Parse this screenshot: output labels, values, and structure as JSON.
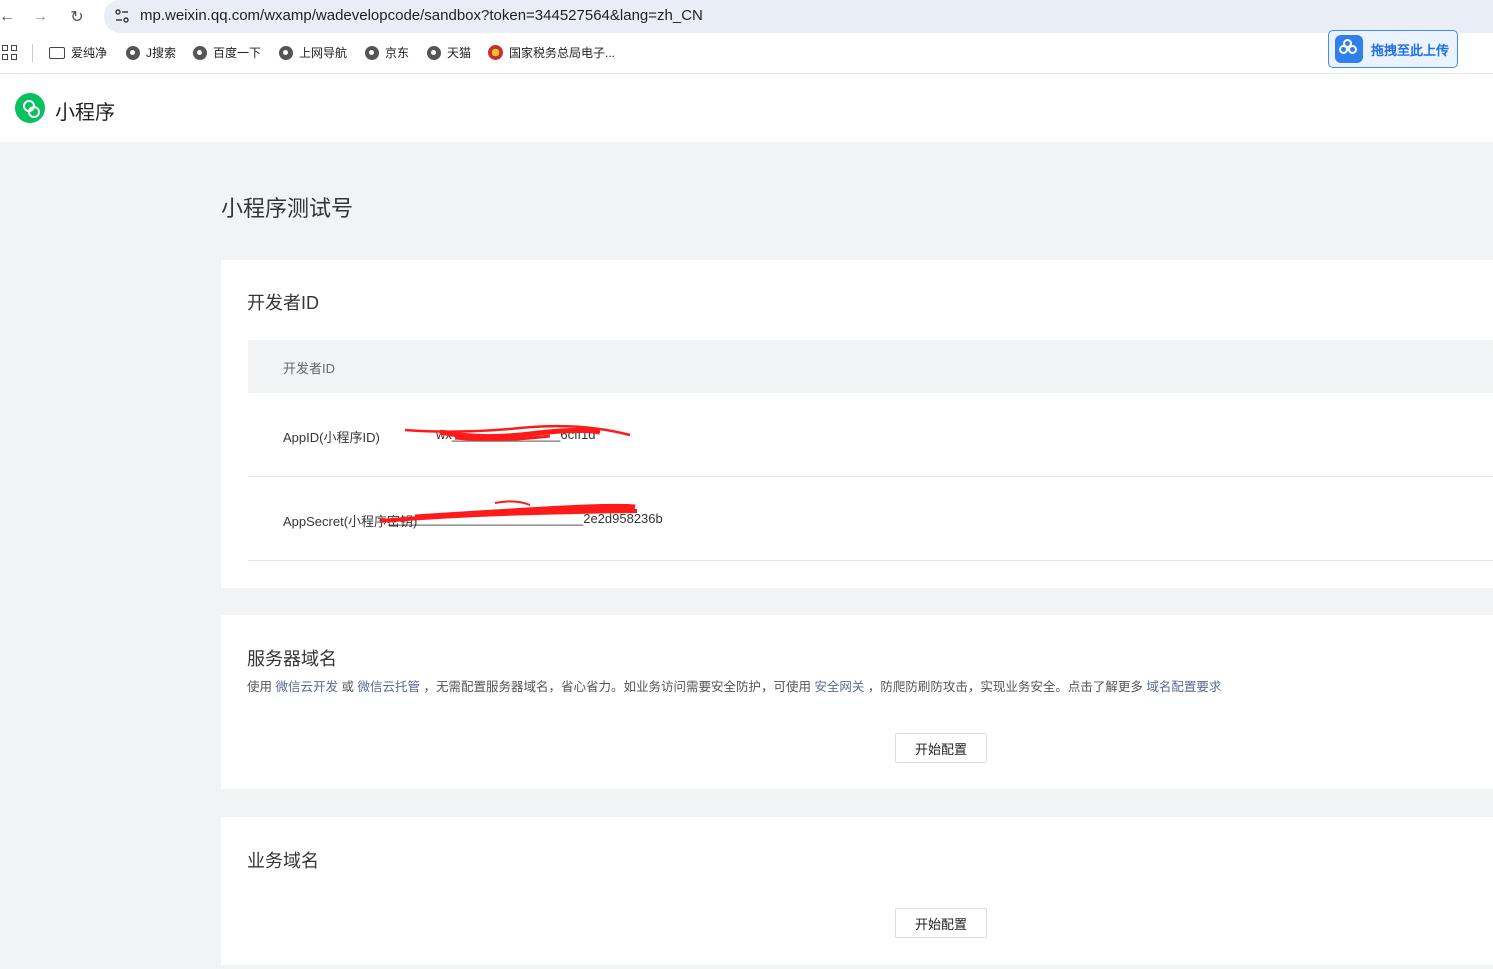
{
  "browser": {
    "url": "mp.weixin.qq.com/wxamp/wadevelopcode/sandbox?token=344527564&lang=zh_CN",
    "bookmarks": [
      "爱纯净",
      "J搜索",
      "百度一下",
      "上网导航",
      "京东",
      "天猫",
      "国家税务总局电子..."
    ],
    "upload_button": "拖拽至此上传"
  },
  "header": {
    "brand": "小程序"
  },
  "page": {
    "title": "小程序测试号"
  },
  "dev_id": {
    "title": "开发者ID",
    "table_header": "开发者ID",
    "rows": [
      {
        "label": "AppID(小程序ID)",
        "value": "wx_______________6cff1d"
      },
      {
        "label": "AppSecret(小程序密钥)",
        "value": "___________________________2e2d958236b"
      }
    ]
  },
  "server_domain": {
    "title": "服务器域名",
    "desc": {
      "t1": "使用 ",
      "l1": "微信云开发",
      "t2": " 或 ",
      "l2": "微信云托管",
      "t3": " ，无需配置服务器域名，省心省力。如业务访问需要安全防护，可使用 ",
      "l3": "安全网关",
      "t4": " ，防爬防刷防攻击，实现业务安全。点击了解更多 ",
      "l4": "域名配置要求"
    },
    "button": "开始配置"
  },
  "business_domain": {
    "title": "业务域名",
    "button": "开始配置"
  },
  "colors": {
    "brand_green": "#07c160",
    "link": "#576b95",
    "redaction": "#ff1a1a"
  }
}
